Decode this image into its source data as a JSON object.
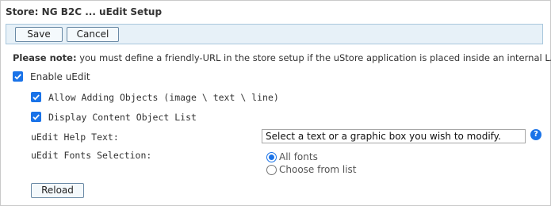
{
  "window": {
    "title": "Store: NG B2C ... uEdit Setup"
  },
  "toolbar": {
    "save_label": "Save",
    "cancel_label": "Cancel"
  },
  "note": {
    "prefix": "Please note:",
    "text": " you must define a friendly-URL in the store setup if the uStore application is placed inside an internal LAN."
  },
  "options": {
    "enable_uedit": {
      "label": "Enable uEdit",
      "checked": true
    },
    "allow_adding_objects": {
      "label": "Allow Adding Objects (image \\ text \\ line)",
      "checked": true
    },
    "display_content_object_list": {
      "label": "Display Content Object List",
      "checked": true
    }
  },
  "help_text": {
    "label": "uEdit Help Text:",
    "value": "Select a text or a graphic box you wish to modify.",
    "help_icon": "?"
  },
  "fonts_selection": {
    "label": "uEdit Fonts Selection:",
    "options": [
      {
        "label": "All fonts",
        "selected": true
      },
      {
        "label": "Choose from list",
        "selected": false
      }
    ]
  },
  "reload_label": "Reload",
  "colors": {
    "accent": "#1a73e8",
    "toolbar_bg": "#e7f1f8",
    "toolbar_border": "#a9c7dd"
  }
}
